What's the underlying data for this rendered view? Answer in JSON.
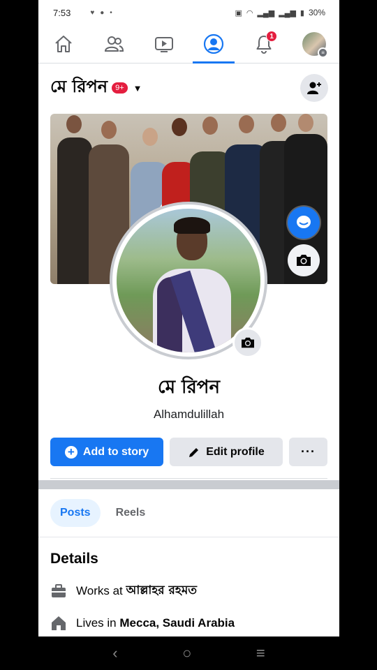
{
  "status_bar": {
    "time": "7:53",
    "battery": "30%"
  },
  "nav": {
    "tabs": [
      {
        "name": "home",
        "icon": "home-icon"
      },
      {
        "name": "friends",
        "icon": "friends-icon"
      },
      {
        "name": "watch",
        "icon": "video-icon"
      },
      {
        "name": "profile",
        "icon": "profile-icon",
        "active": true
      },
      {
        "name": "notifications",
        "icon": "bell-icon",
        "badge": "1"
      },
      {
        "name": "menu",
        "icon": "avatar"
      }
    ]
  },
  "profile": {
    "header_name": "মে রিপন",
    "notification_badge": "9+",
    "display_name": "মে রিপন",
    "bio": "Alhamdulillah"
  },
  "actions": {
    "add_story": "Add to story",
    "edit_profile": "Edit profile",
    "more": "···"
  },
  "content_tabs": {
    "posts": "Posts",
    "reels": "Reels"
  },
  "details": {
    "title": "Details",
    "work_prefix": "Works at ",
    "work_place": "আল্লাহর রহমত",
    "lives_prefix": "Lives in ",
    "lives_place": "Mecca, Saudi Arabia"
  },
  "colors": {
    "accent": "#1877f2",
    "badge": "#e41e3f"
  }
}
